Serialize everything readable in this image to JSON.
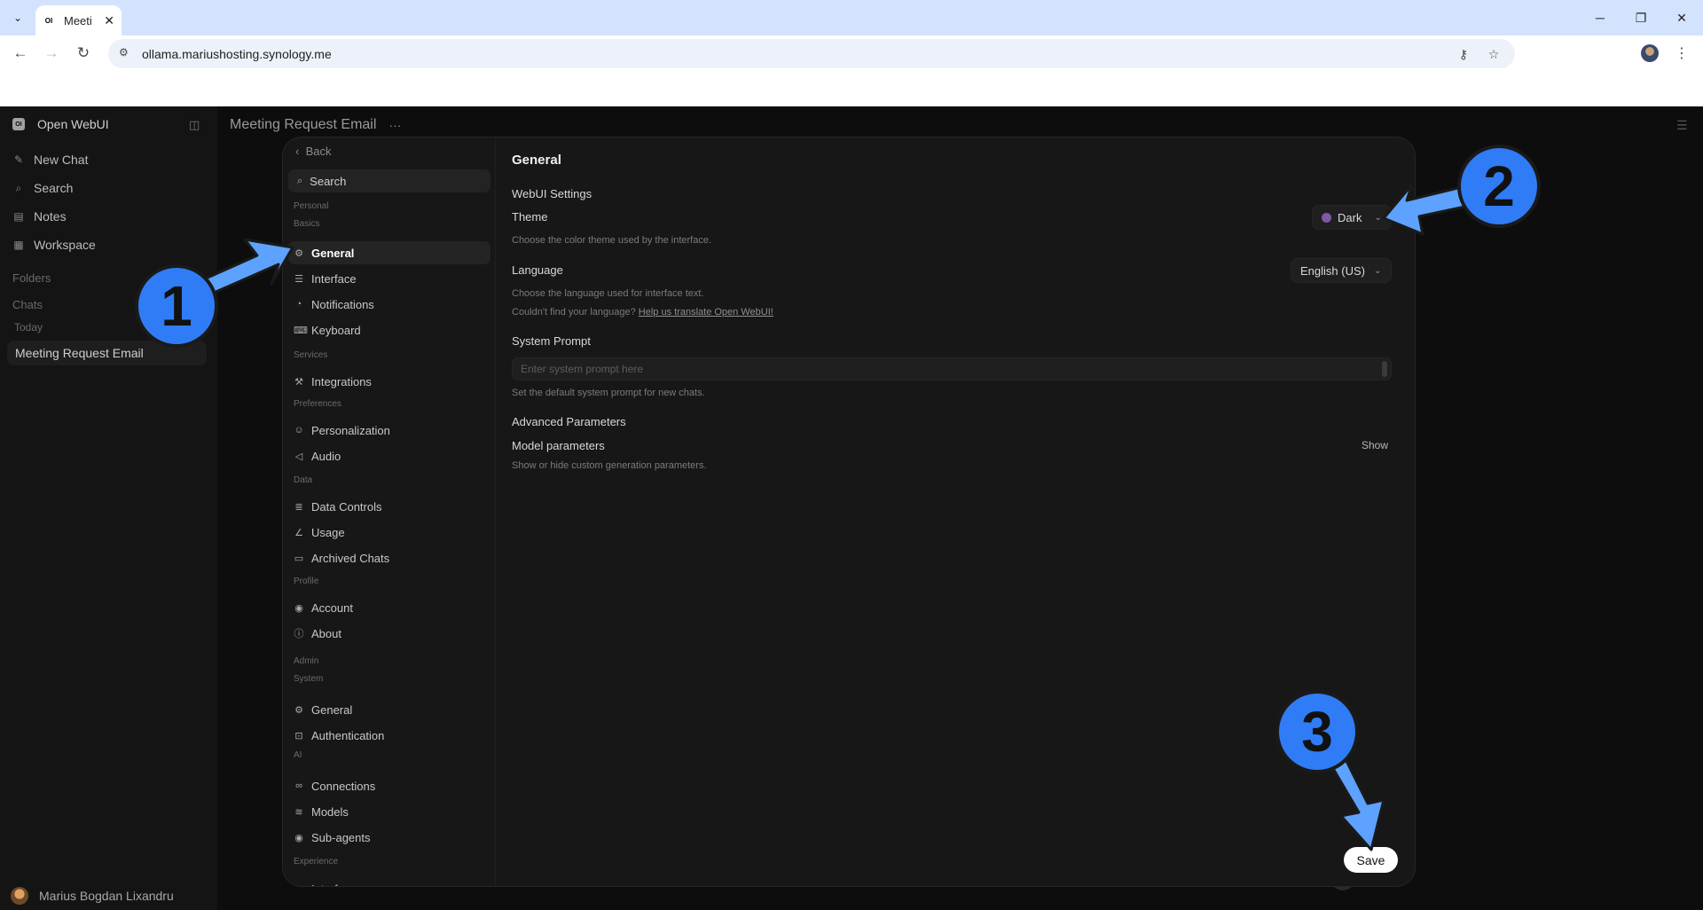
{
  "browser": {
    "tab_title": "Meeti",
    "tab_favicon": "OI",
    "url": "ollama.mariushosting.synology.me"
  },
  "sidebar": {
    "brand": "Open WebUI",
    "brand_logo": "OI",
    "items": [
      {
        "label": "New Chat",
        "icon": "pencil-icon"
      },
      {
        "label": "Search",
        "icon": "search-icon"
      },
      {
        "label": "Notes",
        "icon": "notes-icon"
      },
      {
        "label": "Workspace",
        "icon": "grid-icon"
      }
    ],
    "folders_label": "Folders",
    "chats_label": "Chats",
    "today_label": "Today",
    "active_chat": "Meeting Request Email",
    "user_name": "Marius Bogdan Lixandru"
  },
  "main": {
    "title": "Meeting Request Email",
    "more": "···"
  },
  "settings": {
    "back_label": "Back",
    "search_label": "Search",
    "nav": [
      {
        "type": "section",
        "label": "Personal"
      },
      {
        "type": "section",
        "label": "Basics"
      },
      {
        "type": "item",
        "label": "General",
        "icon": "gear-icon",
        "active": true
      },
      {
        "type": "item",
        "label": "Interface",
        "icon": "sliders-icon"
      },
      {
        "type": "item",
        "label": "Notifications",
        "icon": "bell-icon"
      },
      {
        "type": "item",
        "label": "Keyboard",
        "icon": "keyboard-icon"
      },
      {
        "type": "section",
        "label": "Services"
      },
      {
        "type": "item",
        "label": "Integrations",
        "icon": "wrench-icon"
      },
      {
        "type": "section",
        "label": "Preferences"
      },
      {
        "type": "item",
        "label": "Personalization",
        "icon": "face-icon"
      },
      {
        "type": "item",
        "label": "Audio",
        "icon": "speaker-icon"
      },
      {
        "type": "section",
        "label": "Data"
      },
      {
        "type": "item",
        "label": "Data Controls",
        "icon": "database-icon"
      },
      {
        "type": "item",
        "label": "Usage",
        "icon": "chart-icon"
      },
      {
        "type": "item",
        "label": "Archived Chats",
        "icon": "archive-icon"
      },
      {
        "type": "section",
        "label": "Profile"
      },
      {
        "type": "item",
        "label": "Account",
        "icon": "user-icon"
      },
      {
        "type": "item",
        "label": "About",
        "icon": "info-icon"
      },
      {
        "type": "section",
        "label": "Admin"
      },
      {
        "type": "section",
        "label": "System"
      },
      {
        "type": "item",
        "label": "General",
        "icon": "gear-icon"
      },
      {
        "type": "item",
        "label": "Authentication",
        "icon": "lock-icon"
      },
      {
        "type": "section",
        "label": "AI"
      },
      {
        "type": "item",
        "label": "Connections",
        "icon": "link-icon"
      },
      {
        "type": "item",
        "label": "Models",
        "icon": "stack-icon"
      },
      {
        "type": "item",
        "label": "Sub-agents",
        "icon": "user-icon"
      },
      {
        "type": "section",
        "label": "Experience"
      },
      {
        "type": "item",
        "label": "Interface",
        "icon": "monitor-icon"
      }
    ],
    "content": {
      "heading": "General",
      "webui_settings": "WebUI Settings",
      "theme_label": "Theme",
      "theme_value": "Dark",
      "theme_desc": "Choose the color theme used by the interface.",
      "language_label": "Language",
      "language_value": "English (US)",
      "language_desc": "Choose the language used for interface text.",
      "translate_prefix": "Couldn't find your language?",
      "translate_link": "Help us translate Open WebUI!",
      "system_prompt_label": "System Prompt",
      "system_prompt_placeholder": "Enter system prompt here",
      "system_prompt_desc": "Set the default system prompt for new chats.",
      "advanced_label": "Advanced Parameters",
      "model_params_label": "Model parameters",
      "model_params_toggle": "Show",
      "model_params_desc": "Show or hide custom generation parameters.",
      "save_label": "Save"
    }
  },
  "annotations": [
    "1",
    "2",
    "3"
  ],
  "colors": {
    "annotation_blue": "#2f7cf6",
    "arrow_blue": "#5da2ff",
    "theme_dot": "#7d5aa6"
  }
}
